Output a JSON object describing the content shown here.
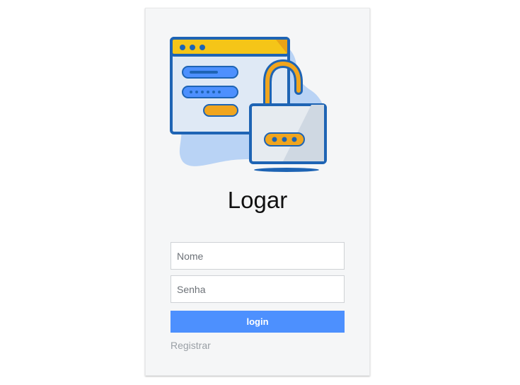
{
  "login_card": {
    "title": "Logar",
    "name_field": {
      "placeholder": "Nome",
      "value": ""
    },
    "password_field": {
      "placeholder": "Senha",
      "value": ""
    },
    "login_button_label": "login",
    "register_link_label": "Registrar",
    "illustration": "login-security-illustration"
  },
  "colors": {
    "accent": "#4d90fe",
    "card_background": "#f5f6f7",
    "illustration_yellow": "#f5c518",
    "illustration_blue": "#1e64b4",
    "illustration_orange": "#f0a51e"
  }
}
